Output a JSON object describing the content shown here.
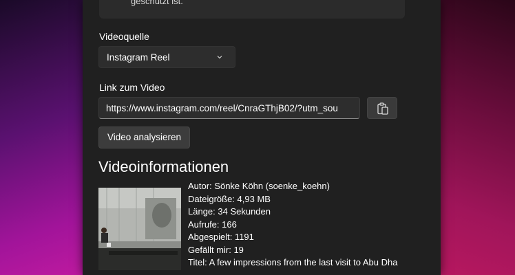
{
  "notice": {
    "text": "geschützt ist."
  },
  "video_source": {
    "label": "Videoquelle",
    "selected": "Instagram Reel"
  },
  "video_link": {
    "label": "Link zum Video",
    "value": "https://www.instagram.com/reel/CnraGThjB02/?utm_sou"
  },
  "analyze_button": {
    "label": "Video analysieren"
  },
  "video_info": {
    "title": "Videoinformationen",
    "lines": [
      "Autor: Sönke Köhn (soenke_koehn)",
      "Dateigröße: 4,93 MB",
      "Länge: 34 Sekunden",
      "Aufrufe: 166",
      "Abgespielt: 1191",
      "Gefällt mir: 19",
      "Titel: A few impressions from the last visit to Abu Dha"
    ]
  },
  "icons": {
    "dropdown": "chevron-down-icon",
    "paste": "clipboard-paste-icon"
  }
}
